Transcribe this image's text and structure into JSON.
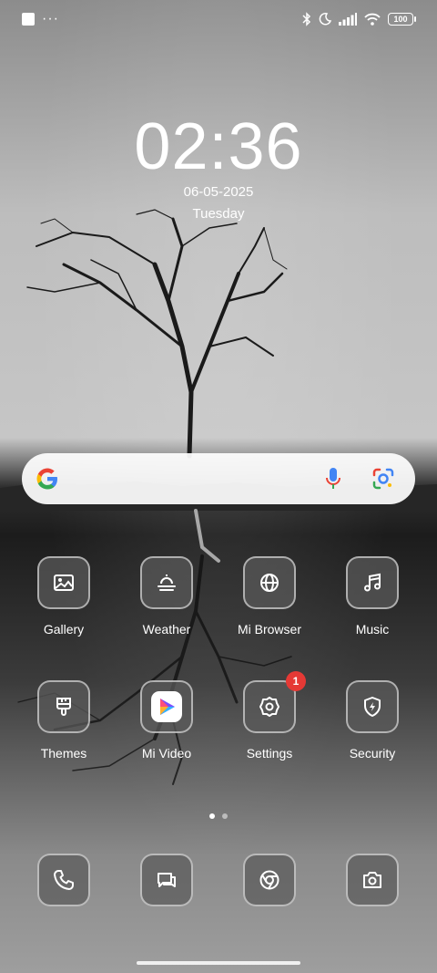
{
  "status_bar": {
    "left_icons": [
      "notification-square-icon",
      "more-dots-icon"
    ],
    "right_icons": [
      "bluetooth-icon",
      "moon-icon",
      "signal-icon",
      "wifi-icon"
    ],
    "more_dots": "···",
    "battery": "100"
  },
  "clock": {
    "time": "02:36",
    "date": "06-05-2025",
    "weekday": "Tuesday"
  },
  "search": {
    "icons": [
      "google-logo-icon",
      "microphone-icon",
      "google-lens-icon"
    ]
  },
  "apps": {
    "row1": [
      {
        "label": "Gallery",
        "icon": "gallery-icon"
      },
      {
        "label": "Weather",
        "icon": "weather-icon"
      },
      {
        "label": "Mi Browser",
        "icon": "globe-icon"
      },
      {
        "label": "Music",
        "icon": "music-note-icon"
      }
    ],
    "row2": [
      {
        "label": "Themes",
        "icon": "paintbrush-icon"
      },
      {
        "label": "Mi Video",
        "icon": "play-icon"
      },
      {
        "label": "Settings",
        "icon": "gear-icon",
        "badge": "1"
      },
      {
        "label": "Security",
        "icon": "shield-icon"
      }
    ]
  },
  "pager": {
    "pages": 2,
    "active": 0
  },
  "dock": [
    {
      "icon": "phone-icon"
    },
    {
      "icon": "messages-icon"
    },
    {
      "icon": "chrome-icon"
    },
    {
      "icon": "camera-icon"
    }
  ],
  "colors": {
    "badge": "#e53935",
    "search_bg": "#ffffff"
  }
}
